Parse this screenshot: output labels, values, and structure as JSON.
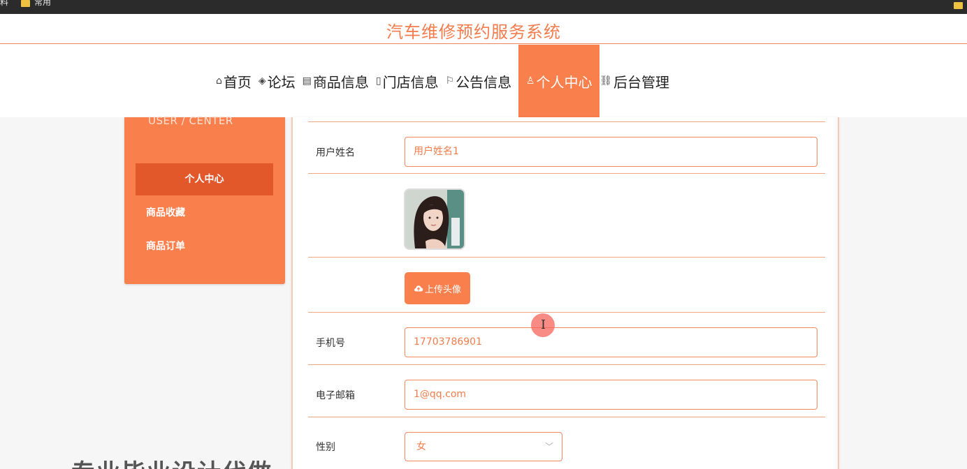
{
  "browser": {
    "bookmark_left": "料",
    "bookmark_folder": "常用"
  },
  "header": {
    "title": "汽车维修预约服务系统"
  },
  "nav": {
    "items": [
      {
        "icon": "home-icon",
        "glyph": "⌂",
        "label": "首页"
      },
      {
        "icon": "layers-icon",
        "glyph": "◈",
        "label": "论坛"
      },
      {
        "icon": "clipboard-icon",
        "glyph": "▤",
        "label": "商品信息"
      },
      {
        "icon": "store-icon",
        "glyph": "▯",
        "label": "门店信息"
      },
      {
        "icon": "flag-icon",
        "glyph": "⚐",
        "label": "公告信息"
      },
      {
        "icon": "user-icon",
        "glyph": "♙",
        "label": "个人中心",
        "active": true
      },
      {
        "icon": "link-icon",
        "glyph": "⛓",
        "label": "后台管理"
      }
    ]
  },
  "sidebar": {
    "subtitle": "USER / CENTER",
    "active_item": "个人中心",
    "items": [
      "商品收藏",
      "商品订单"
    ]
  },
  "form": {
    "username_label": "用户姓名",
    "username_value": "用户姓名1",
    "upload_label": "上传头像",
    "phone_label": "手机号",
    "phone_value": "17703786901",
    "email_label": "电子邮箱",
    "email_value": "1@qq.com",
    "gender_label": "性别",
    "gender_value": "女"
  },
  "overlay": {
    "watermark": "专业毕业设计代做"
  },
  "colors": {
    "accent": "#f97f4d",
    "accent_dark": "#e3582a"
  }
}
